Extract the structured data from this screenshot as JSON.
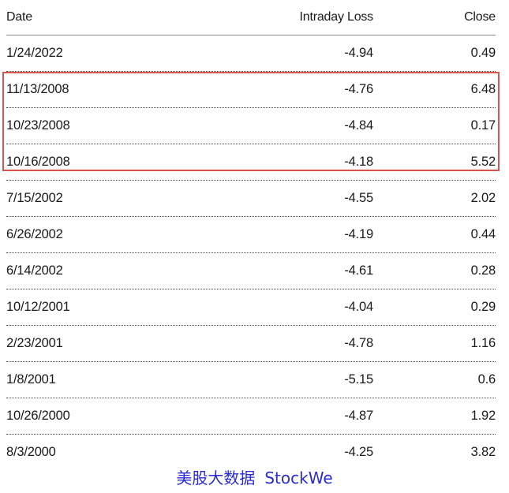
{
  "table": {
    "headers": {
      "date": "Date",
      "loss": "Intraday Loss",
      "close": "Close"
    },
    "rows": [
      {
        "date": "1/24/2022",
        "loss": "-4.94",
        "close": "0.49"
      },
      {
        "date": "11/13/2008",
        "loss": "-4.76",
        "close": "6.48"
      },
      {
        "date": "10/23/2008",
        "loss": "-4.84",
        "close": "0.17"
      },
      {
        "date": "10/16/2008",
        "loss": "-4.18",
        "close": "5.52"
      },
      {
        "date": "7/15/2002",
        "loss": "-4.55",
        "close": "2.02"
      },
      {
        "date": "6/26/2002",
        "loss": "-4.19",
        "close": "0.44"
      },
      {
        "date": "6/14/2002",
        "loss": "-4.61",
        "close": "0.28"
      },
      {
        "date": "10/12/2001",
        "loss": "-4.04",
        "close": "0.29"
      },
      {
        "date": "2/23/2001",
        "loss": "-4.78",
        "close": "1.16"
      },
      {
        "date": "1/8/2001",
        "loss": "-5.15",
        "close": "0.6"
      },
      {
        "date": "10/26/2000",
        "loss": "-4.87",
        "close": "1.92"
      },
      {
        "date": "8/3/2000",
        "loss": "-4.25",
        "close": "3.82"
      }
    ]
  },
  "highlight": {
    "color": "#d9534f"
  },
  "watermark": {
    "cn": "美股大数据",
    "en": "StockWe",
    "color": "#2b2bd6"
  }
}
